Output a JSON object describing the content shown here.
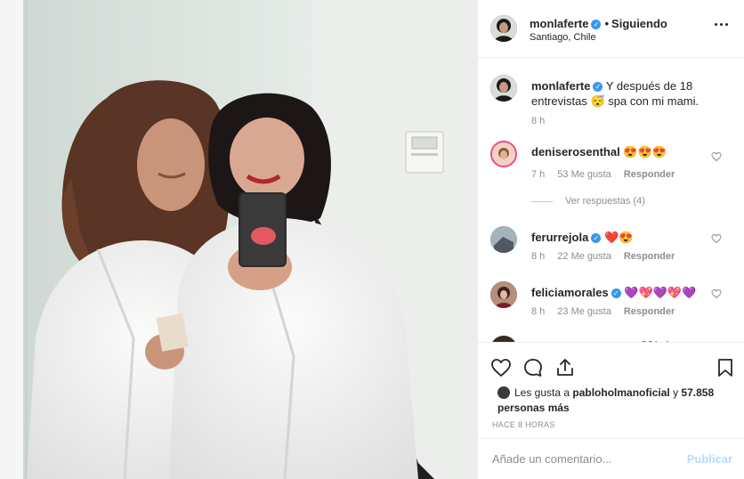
{
  "post": {
    "photo_alt": "",
    "header": {
      "username": "monlaferte",
      "separator": "•",
      "follow_status": "Siguiendo",
      "location": "Santiago, Chile"
    },
    "caption": {
      "username": "monlaferte",
      "text": "Y después de 18 entrevistas 😴 spa con mi mami.",
      "time": "8 h"
    },
    "comments": [
      {
        "username": "deniserosenthal",
        "text": "😍😍😍",
        "time": "7 h",
        "likes": "53 Me gusta",
        "reply": "Responder",
        "verified": false
      },
      {
        "username": "ferurrejola",
        "text": "❤️😍",
        "time": "8 h",
        "likes": "22 Me gusta",
        "reply": "Responder",
        "verified": true
      },
      {
        "username": "feliciamorales",
        "text": "💜💖💜💖💜",
        "time": "8 h",
        "likes": "23 Me gusta",
        "reply": "Responder",
        "verified": true
      },
      {
        "username": "cheeseandbeans",
        "text": "❤️👿",
        "verified": true
      }
    ],
    "view_replies": "Ver respuestas (4)",
    "likes": {
      "prefix": "Les gusta a",
      "user": "pabloholmanoficial",
      "connector": "y",
      "count": "57.858 personas más"
    },
    "timestamp": "HACE 8 HORAS",
    "add_comment": {
      "placeholder": "Añade un comentario...",
      "post_label": "Publicar"
    },
    "icons": {
      "like": "heart-outline-icon",
      "comment": "comment-icon",
      "share": "share-icon",
      "save": "bookmark-icon",
      "more": "more-options-icon"
    },
    "colors": {
      "verified": "#3897f0",
      "meta": "#8e8e8e",
      "post_disabled": "#b3dbff"
    }
  }
}
